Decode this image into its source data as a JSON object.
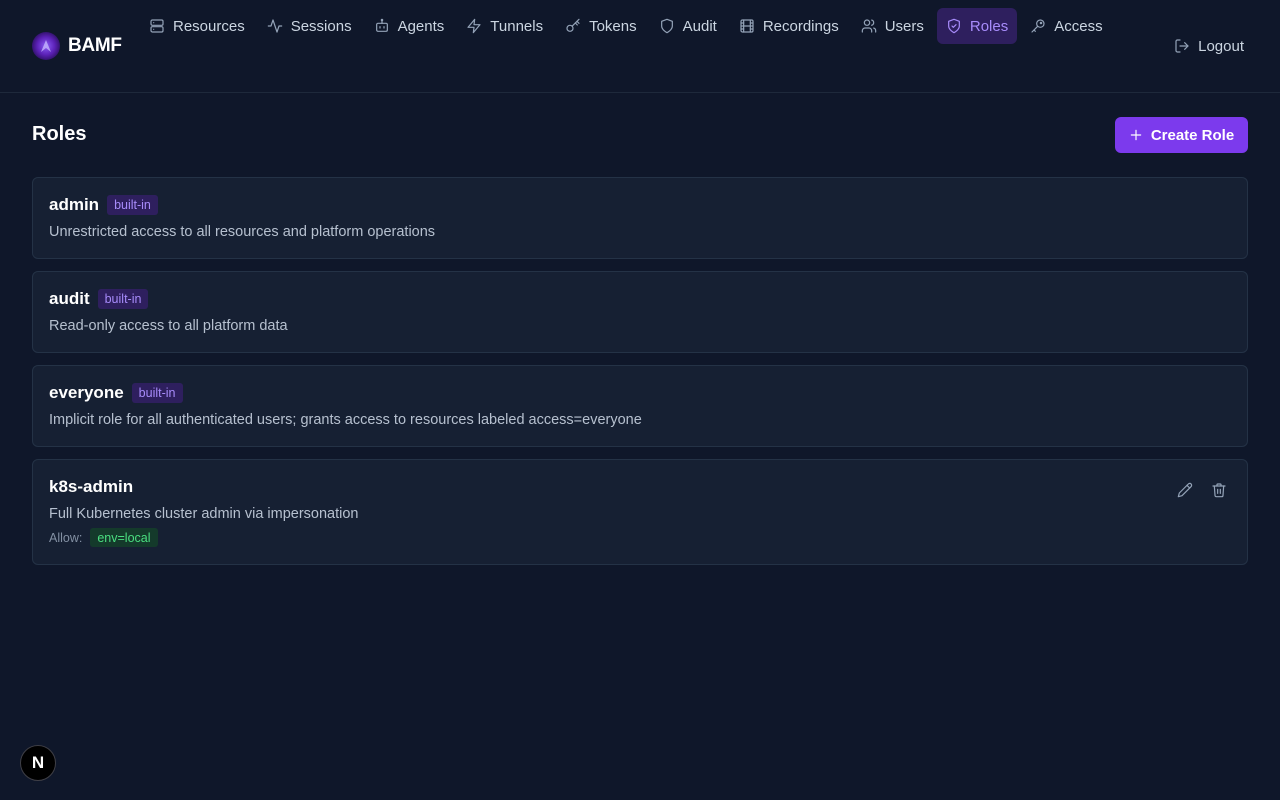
{
  "brand": {
    "name": "BAMF"
  },
  "nav": {
    "items": [
      {
        "label": "Resources",
        "icon": "server-icon"
      },
      {
        "label": "Sessions",
        "icon": "activity-icon"
      },
      {
        "label": "Agents",
        "icon": "bot-icon"
      },
      {
        "label": "Tunnels",
        "icon": "zap-icon"
      },
      {
        "label": "Tokens",
        "icon": "key-icon"
      },
      {
        "label": "Audit",
        "icon": "shield-icon"
      },
      {
        "label": "Recordings",
        "icon": "film-icon"
      },
      {
        "label": "Users",
        "icon": "users-icon"
      },
      {
        "label": "Roles",
        "icon": "shield-check-icon",
        "active": true
      },
      {
        "label": "Access",
        "icon": "key-round-icon"
      }
    ],
    "logout_label": "Logout"
  },
  "page": {
    "title": "Roles",
    "create_button_label": "Create Role"
  },
  "roles": [
    {
      "name": "admin",
      "badge": "built-in",
      "description": "Unrestricted access to all resources and platform operations"
    },
    {
      "name": "audit",
      "badge": "built-in",
      "description": "Read-only access to all platform data"
    },
    {
      "name": "everyone",
      "badge": "built-in",
      "description": "Implicit role for all authenticated users; grants access to resources labeled access=everyone"
    },
    {
      "name": "k8s-admin",
      "description": "Full Kubernetes cluster admin via impersonation",
      "allow_label": "Allow:",
      "allow_tags": [
        "env=local"
      ]
    }
  ],
  "dev_indicator": {
    "label": "N"
  },
  "colors": {
    "accent": "#7c3aed",
    "background": "#0f172a",
    "card": "#162033",
    "allow_tag": "#4ade80"
  }
}
